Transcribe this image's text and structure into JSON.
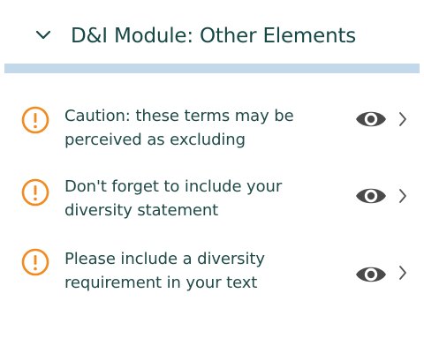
{
  "panel": {
    "title": "D&I Module: Other Elements",
    "collapse_icon": "chevron-down-icon"
  },
  "colors": {
    "title_text": "#174846",
    "body_text": "#1f4a47",
    "divider": "#c3d8ea",
    "warning": "#f28a1e",
    "eye": "#4a4a4a",
    "chevron": "#555555"
  },
  "items": [
    {
      "text": "Caution: these terms may be perceived as excluding",
      "icons": [
        "warning-icon",
        "eye-icon",
        "chevron-right-icon"
      ]
    },
    {
      "text": "Don't forget to include your diversity statement",
      "icons": [
        "warning-icon",
        "eye-icon",
        "chevron-right-icon"
      ]
    },
    {
      "text": "Please include a diversity requirement in your text",
      "icons": [
        "warning-icon",
        "eye-icon",
        "chevron-right-icon"
      ]
    }
  ]
}
